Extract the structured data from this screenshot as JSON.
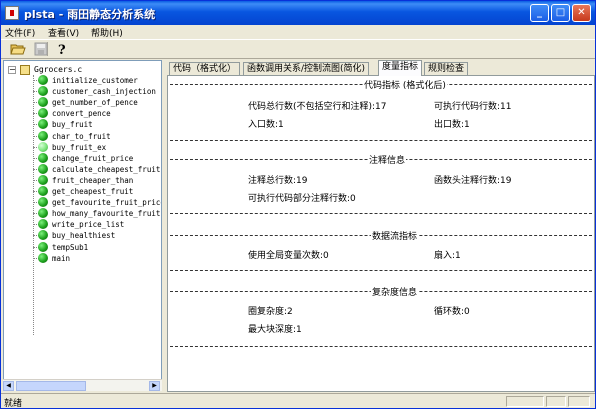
{
  "window": {
    "title": "plsta - 雨田静态分析系统"
  },
  "title_buttons": {
    "minimize": "_",
    "maximize": "□",
    "close": "✕"
  },
  "menu": [
    {
      "label": "文件(F)"
    },
    {
      "label": "查看(V)"
    },
    {
      "label": "帮助(H)"
    }
  ],
  "toolbar": {
    "open_icon": "folder-open-icon",
    "save_icon": "save-icon",
    "help_icon": "help-icon"
  },
  "tree": {
    "root": "Ggrocers.c",
    "expander": "−",
    "items": [
      "initialize_customer",
      "customer_cash_injection",
      "get_number_of_pence",
      "convert_pence",
      "buy_fruit",
      "char_to_fruit",
      "buy_fruit_ex",
      "change_fruit_price",
      "calculate_cheapest_fruit",
      "fruit_cheaper_than",
      "get_cheapest_fruit",
      "get_favourite_fruit_price",
      "how_many_favourite_fruit",
      "write_price_list",
      "buy_healthiest",
      "tempSub1",
      "main"
    ],
    "highlighted_index": 6
  },
  "tabs": [
    {
      "label": "代码（格式化）"
    },
    {
      "label": "函数调用关系/控制流图(简化)"
    },
    {
      "label": "度量指标"
    },
    {
      "label": "规则检查"
    }
  ],
  "active_tab": 2,
  "sections": {
    "code": {
      "title": "代码指标 (格式化后)",
      "total_lines": "代码总行数(不包括空行和注释):17",
      "exec_lines": "可执行代码行数:11",
      "entry": "入口数:1",
      "exit": "出口数:1"
    },
    "comment": {
      "title": "注释信息",
      "total": "注释总行数:19",
      "func_header": "函数头注释行数:19",
      "exec_part": "可执行代码部分注释行数:0"
    },
    "dataflow": {
      "title": "数据流指标",
      "globals": "使用全局变量次数:0",
      "fan_in": "扇入:1"
    },
    "complexity": {
      "title": "复杂度信息",
      "cyclomatic": "圈复杂度:2",
      "loops": "循环数:0",
      "nesting": "最大块深度:1"
    }
  },
  "status": {
    "text": "就绪"
  }
}
